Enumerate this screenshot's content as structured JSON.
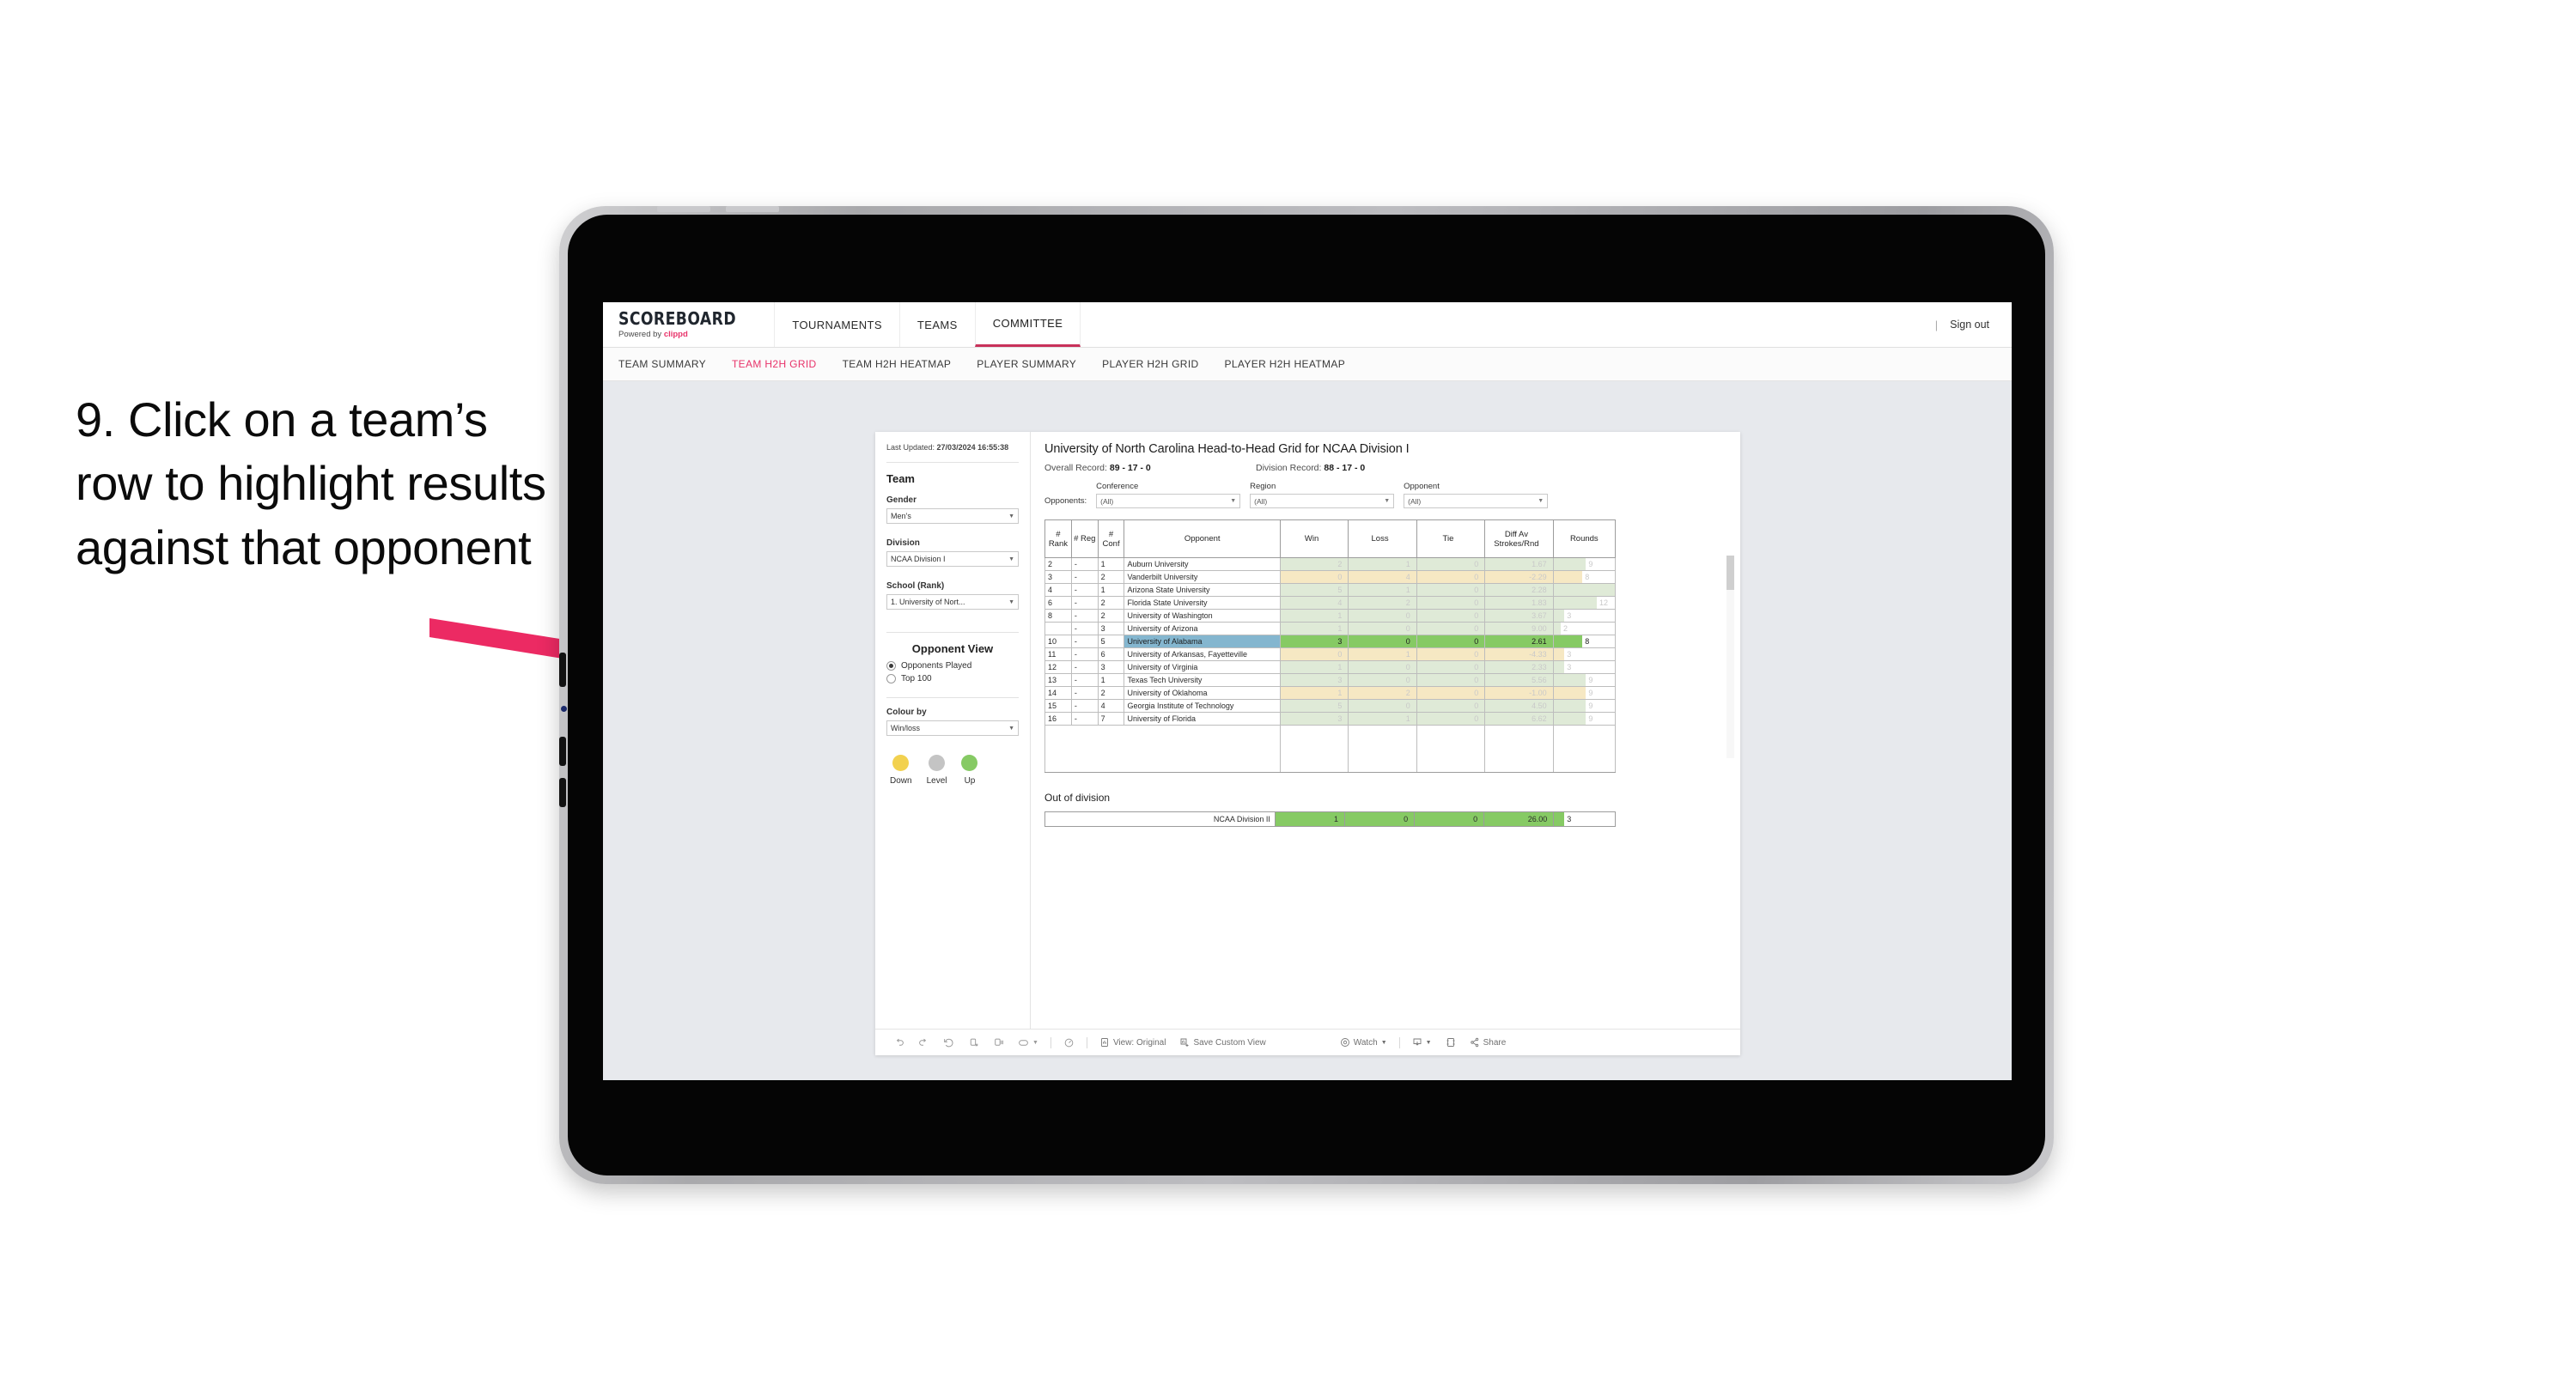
{
  "instruction": {
    "text": "9. Click on a team’s row to highlight results against that opponent"
  },
  "app": {
    "brand_name": "SCOREBOARD",
    "brand_sub_prefix": "Powered by ",
    "brand_sub_accent": "clippd",
    "accent_color": "#e8336a",
    "top_nav": [
      {
        "label": "TOURNAMENTS",
        "active": false
      },
      {
        "label": "TEAMS",
        "active": false
      },
      {
        "label": "COMMITTEE",
        "active": true
      }
    ],
    "sign_out": "Sign out",
    "divider": "|",
    "sub_nav": [
      {
        "label": "TEAM SUMMARY",
        "active": false
      },
      {
        "label": "TEAM H2H GRID",
        "active": true
      },
      {
        "label": "TEAM H2H HEATMAP",
        "active": false
      },
      {
        "label": "PLAYER SUMMARY",
        "active": false
      },
      {
        "label": "PLAYER H2H GRID",
        "active": false
      },
      {
        "label": "PLAYER H2H HEATMAP",
        "active": false
      }
    ]
  },
  "sidebar": {
    "last_updated_label": "Last Updated: ",
    "last_updated_value": "27/03/2024 16:55:38",
    "team_heading": "Team",
    "gender_label": "Gender",
    "gender_value": "Men’s",
    "division_label": "Division",
    "division_value": "NCAA Division I",
    "school_label": "School (Rank)",
    "school_value": "1. University of Nort...",
    "opponent_view_heading": "Opponent View",
    "opponent_view_options": [
      {
        "label": "Opponents Played",
        "selected": true
      },
      {
        "label": "Top 100",
        "selected": false
      }
    ],
    "colour_by_label": "Colour by",
    "colour_by_value": "Win/loss",
    "legend": [
      {
        "label": "Down",
        "color": "#f2d14f"
      },
      {
        "label": "Level",
        "color": "#c4c4c4"
      },
      {
        "label": "Up",
        "color": "#86ca64"
      }
    ]
  },
  "view": {
    "title": "University of North Carolina Head-to-Head Grid for NCAA Division I",
    "overall_record_label": "Overall Record: ",
    "overall_record_value": "89 - 17 - 0",
    "division_record_label": "Division Record: ",
    "division_record_value": "88 - 17 - 0",
    "opponents_label": "Opponents:",
    "filters": [
      {
        "caption": "Conference",
        "value": "(All)"
      },
      {
        "caption": "Region",
        "value": "(All)"
      },
      {
        "caption": "Opponent",
        "value": "(All)"
      }
    ]
  },
  "chart_data": {
    "type": "table",
    "title": "University of North Carolina Head-to-Head Grid for NCAA Division I",
    "columns": [
      "# Rank",
      "# Reg",
      "# Conf",
      "Opponent",
      "Win",
      "Loss",
      "Tie",
      "Diff Av Strokes/Rnd",
      "Rounds"
    ],
    "rows": [
      {
        "rank": "2",
        "reg": "-",
        "conf": "1",
        "opponent": "Auburn University",
        "win": "2",
        "loss": "1",
        "tie": "0",
        "diff": "1.67",
        "rounds": "9",
        "result": "up",
        "selected": false
      },
      {
        "rank": "3",
        "reg": "-",
        "conf": "2",
        "opponent": "Vanderbilt University",
        "win": "0",
        "loss": "4",
        "tie": "0",
        "diff": "-2.29",
        "rounds": "8",
        "result": "down",
        "selected": false
      },
      {
        "rank": "4",
        "reg": "-",
        "conf": "1",
        "opponent": "Arizona State University",
        "win": "5",
        "loss": "1",
        "tie": "0",
        "diff": "2.28",
        "rounds": "17",
        "result": "up",
        "selected": false
      },
      {
        "rank": "6",
        "reg": "-",
        "conf": "2",
        "opponent": "Florida State University",
        "win": "4",
        "loss": "2",
        "tie": "0",
        "diff": "1.83",
        "rounds": "12",
        "result": "up",
        "selected": false
      },
      {
        "rank": "8",
        "reg": "-",
        "conf": "2",
        "opponent": "University of Washington",
        "win": "1",
        "loss": "0",
        "tie": "0",
        "diff": "3.67",
        "rounds": "3",
        "result": "up",
        "selected": false
      },
      {
        "rank": "",
        "reg": "-",
        "conf": "3",
        "opponent": "University of Arizona",
        "win": "1",
        "loss": "0",
        "tie": "0",
        "diff": "9.00",
        "rounds": "2",
        "result": "up",
        "selected": false
      },
      {
        "rank": "10",
        "reg": "-",
        "conf": "5",
        "opponent": "University of Alabama",
        "win": "3",
        "loss": "0",
        "tie": "0",
        "diff": "2.61",
        "rounds": "8",
        "result": "up",
        "selected": true
      },
      {
        "rank": "11",
        "reg": "-",
        "conf": "6",
        "opponent": "University of Arkansas, Fayetteville",
        "win": "0",
        "loss": "1",
        "tie": "0",
        "diff": "-4.33",
        "rounds": "3",
        "result": "down",
        "selected": false
      },
      {
        "rank": "12",
        "reg": "-",
        "conf": "3",
        "opponent": "University of Virginia",
        "win": "1",
        "loss": "0",
        "tie": "0",
        "diff": "2.33",
        "rounds": "3",
        "result": "up",
        "selected": false
      },
      {
        "rank": "13",
        "reg": "-",
        "conf": "1",
        "opponent": "Texas Tech University",
        "win": "3",
        "loss": "0",
        "tie": "0",
        "diff": "5.56",
        "rounds": "9",
        "result": "up",
        "selected": false
      },
      {
        "rank": "14",
        "reg": "-",
        "conf": "2",
        "opponent": "University of Oklahoma",
        "win": "1",
        "loss": "2",
        "tie": "0",
        "diff": "-1.00",
        "rounds": "9",
        "result": "down",
        "selected": false
      },
      {
        "rank": "15",
        "reg": "-",
        "conf": "4",
        "opponent": "Georgia Institute of Technology",
        "win": "5",
        "loss": "0",
        "tie": "0",
        "diff": "4.50",
        "rounds": "9",
        "result": "up",
        "selected": false
      },
      {
        "rank": "16",
        "reg": "-",
        "conf": "7",
        "opponent": "University of Florida",
        "win": "3",
        "loss": "1",
        "tie": "0",
        "diff": "6.62",
        "rounds": "9",
        "result": "up",
        "selected": false
      }
    ],
    "rounds_max": 17,
    "colors": {
      "up": "#86ca64",
      "down": "#f6e8c3",
      "up_dim": "#dfead7",
      "selected_row": "#84b6cf"
    }
  },
  "out_of_division": {
    "heading": "Out of division",
    "row": {
      "label": "NCAA Division II",
      "win": "1",
      "loss": "0",
      "tie": "0",
      "diff": "26.00",
      "rounds": "3"
    }
  },
  "toolbar": {
    "view_label": "View: Original",
    "save_label": "Save Custom View",
    "watch_label": "Watch",
    "share_label": "Share",
    "caret": "▾"
  }
}
